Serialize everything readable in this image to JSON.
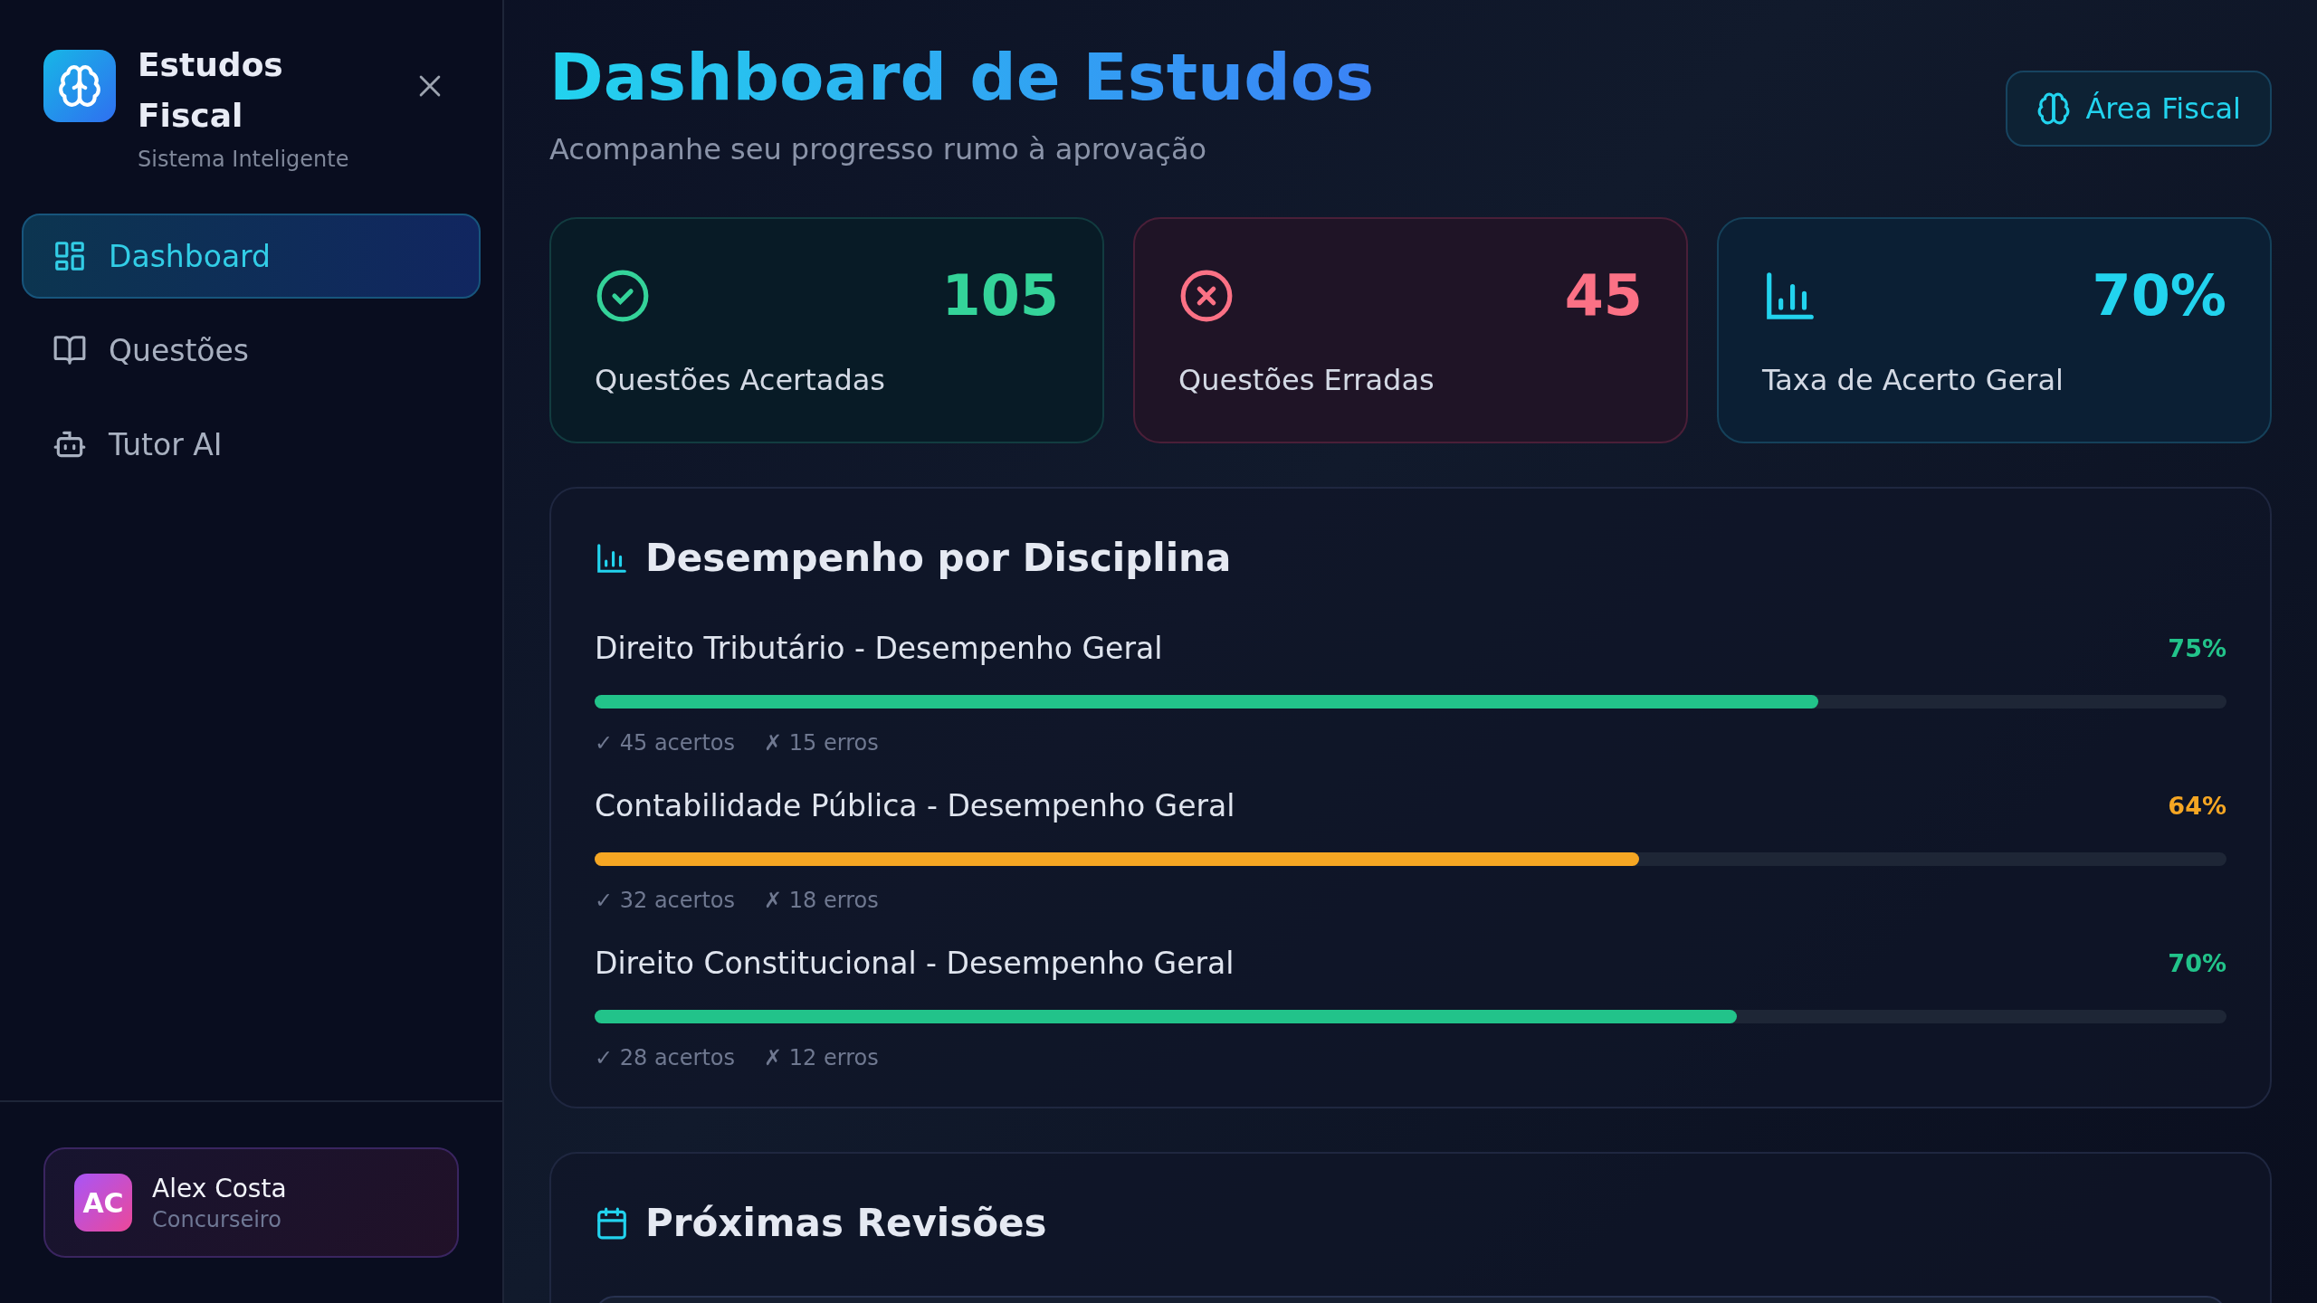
{
  "sidebar": {
    "brand": {
      "title": "Estudos Fiscal",
      "subtitle": "Sistema Inteligente"
    },
    "items": [
      {
        "label": "Dashboard",
        "kind": "grid",
        "selected": true
      },
      {
        "label": "Questões",
        "kind": "book",
        "selected": false
      },
      {
        "label": "Tutor AI",
        "kind": "robot",
        "selected": false
      }
    ],
    "user": {
      "initials": "AC",
      "name": "Alex Costa",
      "role": "Concurseiro"
    }
  },
  "header": {
    "title": "Dashboard de Estudos",
    "subtitle": "Acompanhe seu progresso rumo à aprovação",
    "button": "Área Fiscal"
  },
  "stats": [
    {
      "kind": "correct",
      "value": "105",
      "label": "Questões Acertadas"
    },
    {
      "kind": "wrong",
      "value": "45",
      "label": "Questões Erradas"
    },
    {
      "kind": "rate",
      "value": "70%",
      "label": "Taxa de Acerto Geral"
    }
  ],
  "performance": {
    "title": "Desempenho por Disciplina",
    "subjects": [
      {
        "name": "Direito Tributário - Desempenho Geral",
        "percent": "75%",
        "level": 0.75,
        "color": "#22c38a",
        "correct": "✓ 45 acertos",
        "wrong": "✗ 15 erros"
      },
      {
        "name": "Contabilidade Pública - Desempenho Geral",
        "percent": "64%",
        "level": 0.64,
        "color": "#f5a623",
        "correct": "✓ 32 acertos",
        "wrong": "✗ 18 erros"
      },
      {
        "name": "Direito Constitucional - Desempenho Geral",
        "percent": "70%",
        "level": 0.7,
        "color": "#22c38a",
        "correct": "✓ 28 acertos",
        "wrong": "✗ 12 erros"
      }
    ]
  },
  "reviews": {
    "title": "Próximas Revisões",
    "items": [
      {
        "kind": "card"
      }
    ]
  }
}
